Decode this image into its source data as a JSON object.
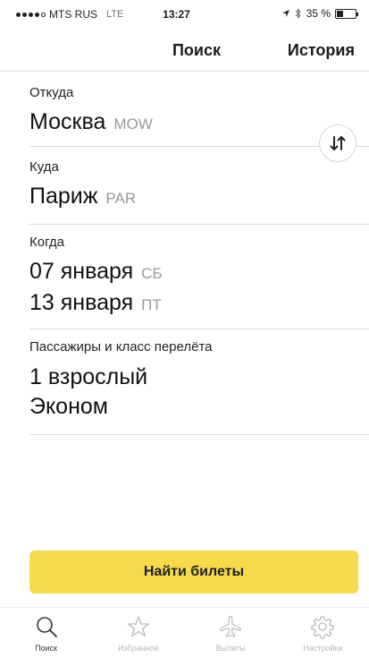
{
  "status_bar": {
    "carrier": "MTS RUS",
    "network": "LTE",
    "time": "13:27",
    "battery": "35 %",
    "battery_level": 0.35
  },
  "nav": {
    "title": "Поиск",
    "history": "История"
  },
  "form": {
    "from": {
      "label": "Откуда",
      "city": "Москва",
      "code": "MOW"
    },
    "to": {
      "label": "Куда",
      "city": "Париж",
      "code": "PAR"
    },
    "when": {
      "label": "Когда",
      "depart_date": "07 января",
      "depart_day": "СБ",
      "return_date": "13 января",
      "return_day": "ПТ"
    },
    "passengers": {
      "label": "Пассажиры и класс перелёта",
      "count": "1 взрослый",
      "class": "Эконом"
    }
  },
  "search_button": "Найти билеты",
  "colors": {
    "accent": "#f7d94c",
    "muted": "#9a9a9a"
  },
  "tabs": [
    {
      "label": "Поиск",
      "icon": "search-icon",
      "active": true
    },
    {
      "label": "Избранное",
      "icon": "star-icon",
      "active": false
    },
    {
      "label": "Вылеты",
      "icon": "airplane-icon",
      "active": false
    },
    {
      "label": "Настройки",
      "icon": "gear-icon",
      "active": false
    }
  ]
}
